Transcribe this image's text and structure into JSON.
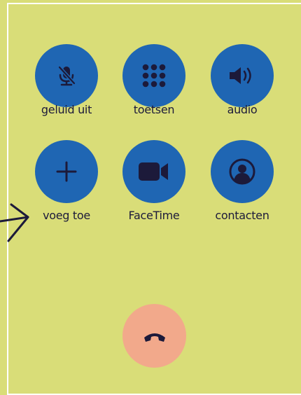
{
  "buttons": [
    {
      "label": "geluid uit",
      "icon": "mic-muted-icon"
    },
    {
      "label": "toetsen",
      "icon": "keypad-icon"
    },
    {
      "label": "audio",
      "icon": "speaker-icon"
    },
    {
      "label": "voeg toe",
      "icon": "plus-icon"
    },
    {
      "label": "FaceTime",
      "icon": "video-camera-icon"
    },
    {
      "label": "contacten",
      "icon": "contact-icon"
    }
  ],
  "end_call": {
    "icon": "end-call-icon"
  },
  "colors": {
    "background": "#d9dd78",
    "button": "#1f66b3",
    "icon": "#1c1a3a",
    "end_call": "#f2a98b",
    "label": "#1c1a3a"
  }
}
